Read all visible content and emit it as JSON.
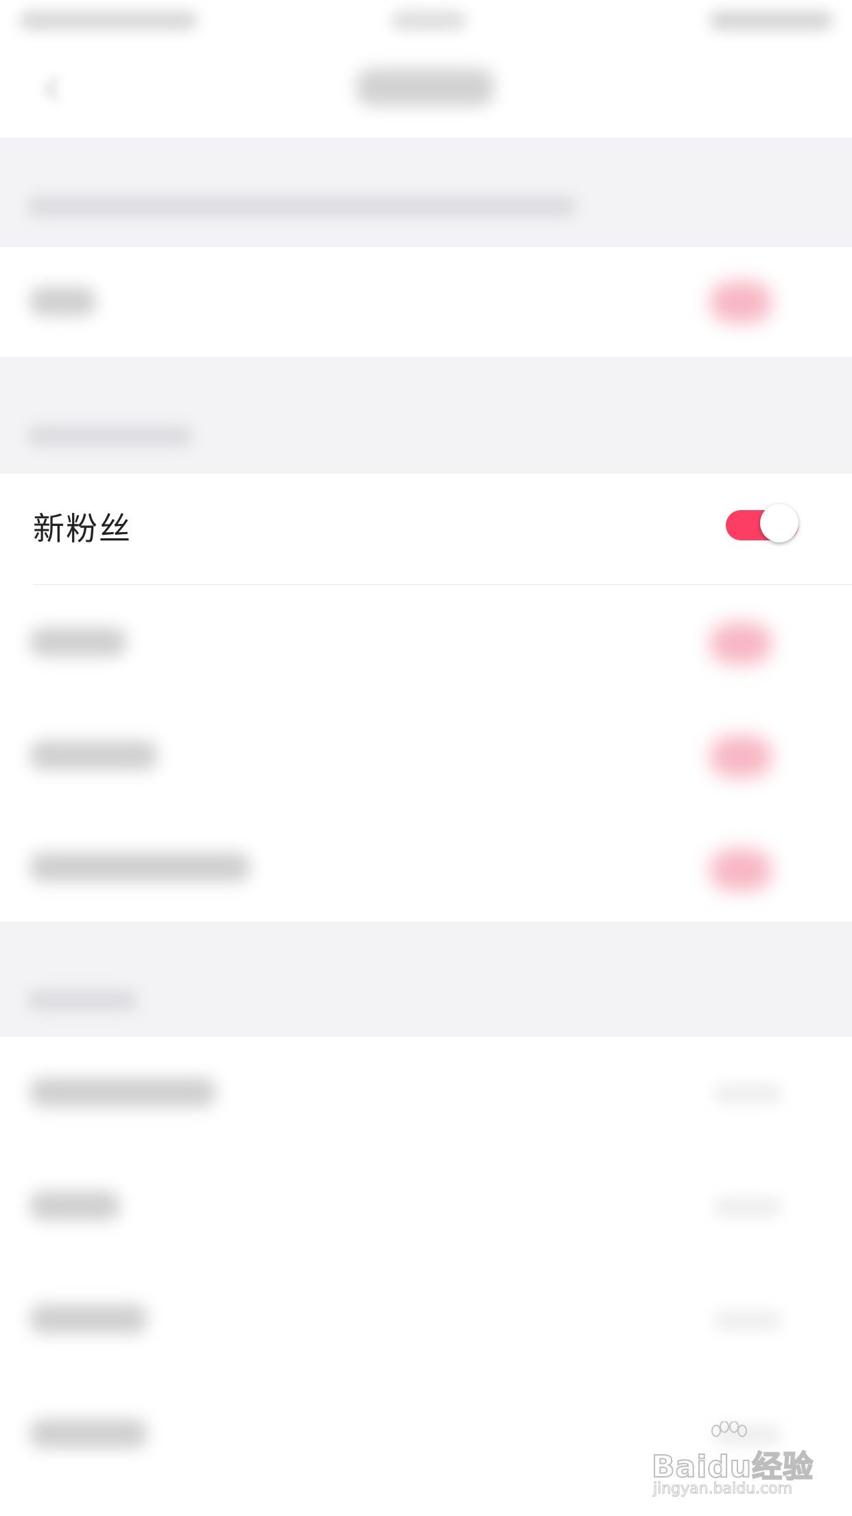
{
  "focused_row": {
    "label": "新粉丝",
    "toggle_on": true
  },
  "colors": {
    "accent": "#fd3e62",
    "section_background": "#f3f3f5",
    "row_background": "#ffffff"
  },
  "icons": {
    "back": "chevron-left-icon"
  },
  "watermark": {
    "logo_text": "Baidu经验",
    "url": "jingyan.baidu.com"
  }
}
